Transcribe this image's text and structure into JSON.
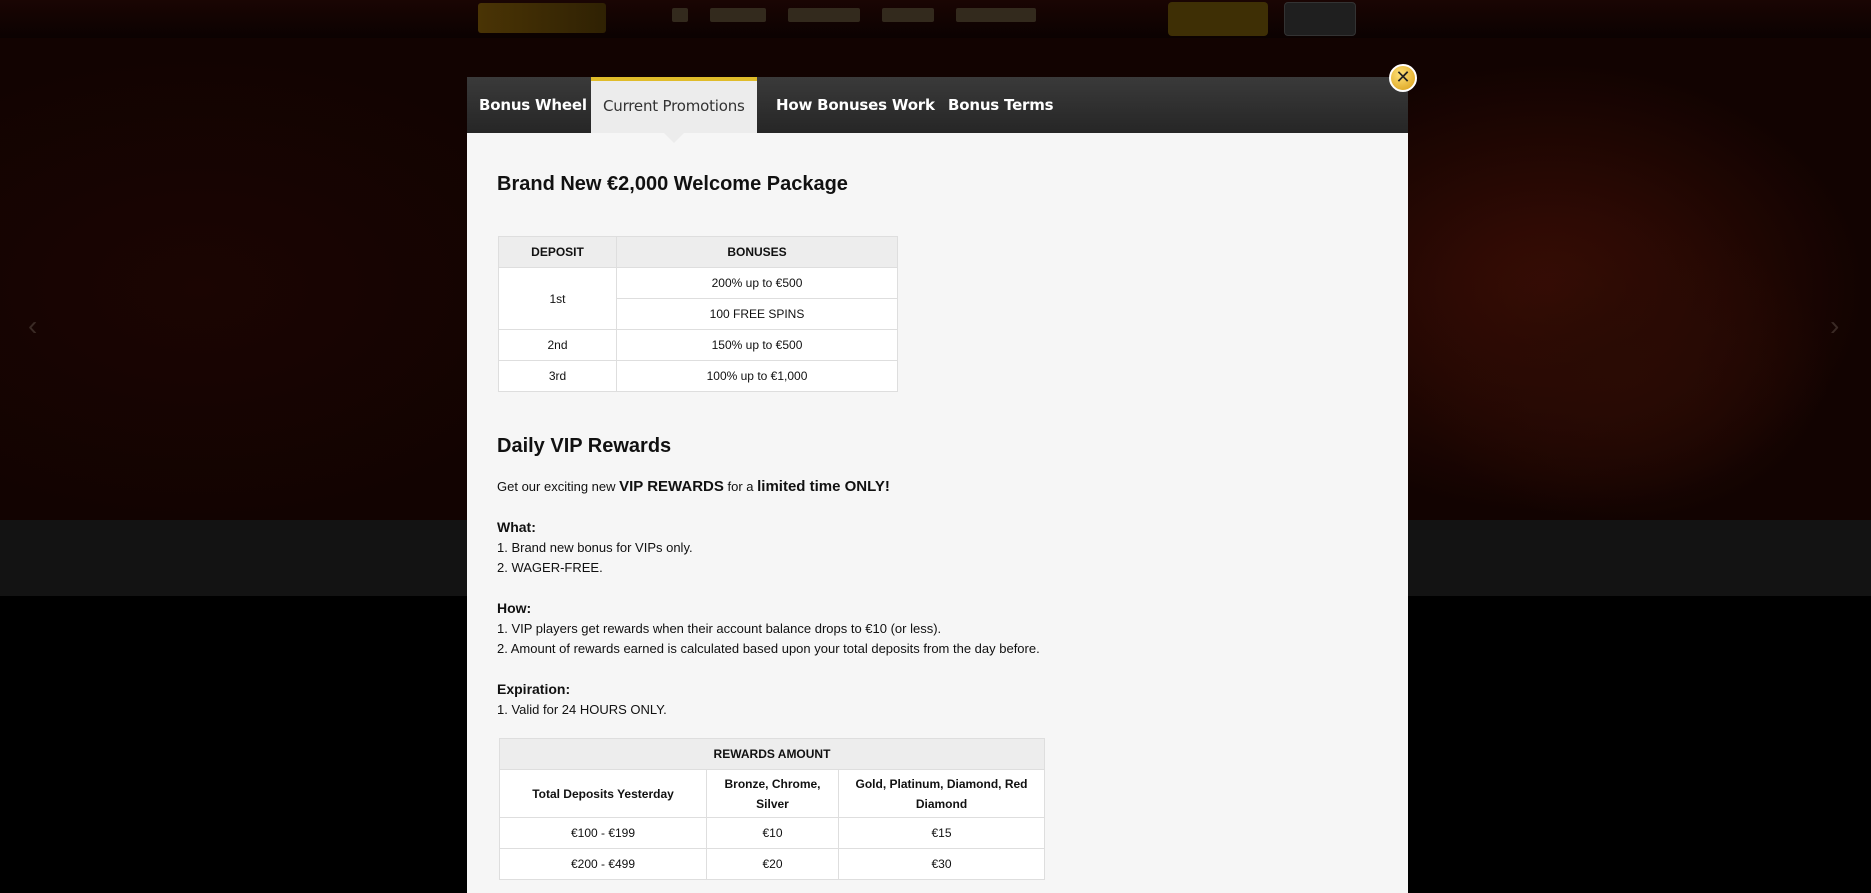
{
  "modal": {
    "tabs": [
      {
        "label": "Bonus Wheel",
        "active": false
      },
      {
        "label": "Current Promotions",
        "active": true
      },
      {
        "label": "How Bonuses Work",
        "active": false
      },
      {
        "label": "Bonus Terms",
        "active": false
      }
    ],
    "close_label": "✕"
  },
  "welcome": {
    "title": "Brand New €2,000 Welcome Package",
    "headers": [
      "DEPOSIT",
      "BONUSES"
    ],
    "rows": [
      {
        "deposit": "1st",
        "bonuses": [
          "200% up to €500",
          "100 FREE SPINS"
        ]
      },
      {
        "deposit": "2nd",
        "bonuses": [
          "150% up to €500"
        ]
      },
      {
        "deposit": "3rd",
        "bonuses": [
          "100% up to €1,000"
        ]
      }
    ]
  },
  "vip": {
    "title": "Daily VIP Rewards",
    "intro_1": "Get our exciting new ",
    "intro_2": "VIP REWARDS",
    "intro_3": " for a ",
    "intro_4": "limited time ONLY!",
    "what_head": "What:",
    "what": [
      "1. Brand new bonus for VIPs only.",
      "2. WAGER-FREE."
    ],
    "how_head": "How:",
    "how": [
      "1. VIP players get rewards when their account balance drops to €10 (or less).",
      "2. Amount of rewards earned is calculated based upon your total deposits from the day before."
    ],
    "exp_head": "Expiration:",
    "exp": [
      "1. Valid for 24 HOURS ONLY."
    ],
    "rewards_table": {
      "title": "REWARDS AMOUNT",
      "headers": [
        "Total Deposits Yesterday",
        "Bronze, Chrome, Silver",
        "Gold, Platinum, Diamond, Red Diamond"
      ],
      "rows": [
        [
          "€100 - €199",
          "€10",
          "€15"
        ],
        [
          "€200 - €499",
          "€20",
          "€30"
        ]
      ]
    }
  },
  "colors": {
    "accent": "#e0bc2a",
    "tabbar": "#2f2f2f",
    "modal_bg": "#f6f6f6"
  }
}
